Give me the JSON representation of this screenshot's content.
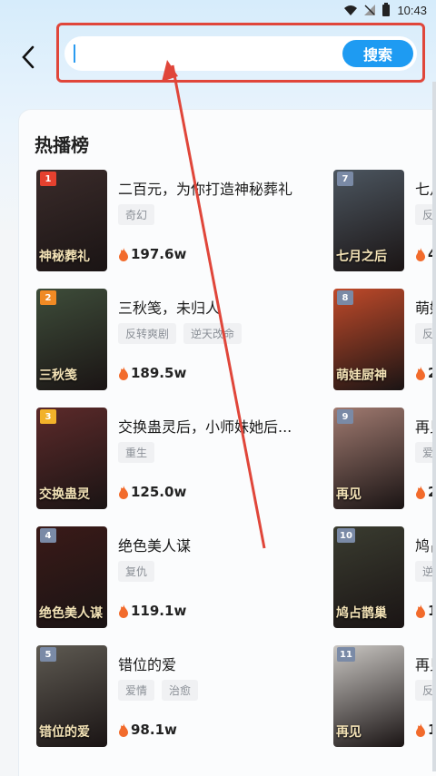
{
  "status": {
    "time": "10:43"
  },
  "search": {
    "placeholder": "",
    "value": "",
    "button_label": "搜索"
  },
  "section_title": "热播榜",
  "left_items": [
    {
      "rank": "1",
      "title": "二百元，为你打造神秘葬礼",
      "tags": [
        "奇幻"
      ],
      "heat": "197.6w",
      "poster_text": "神秘葬礼",
      "rank_color": "#e5412f",
      "poster_bg": "#3a2b2a"
    },
    {
      "rank": "2",
      "title": "三秋笺，未归人",
      "tags": [
        "反转爽剧",
        "逆天改命"
      ],
      "heat": "189.5w",
      "poster_text": "三秋笺",
      "rank_color": "#f08a24",
      "poster_bg": "#3e4d3a"
    },
    {
      "rank": "3",
      "title": "交换蛊灵后，小师妹她后...",
      "tags": [
        "重生"
      ],
      "heat": "125.0w",
      "poster_text": "交换蛊灵",
      "rank_color": "#f2b22a",
      "poster_bg": "#5c2a2a"
    },
    {
      "rank": "4",
      "title": "绝色美人谋",
      "tags": [
        "复仇"
      ],
      "heat": "119.1w",
      "poster_text": "绝色美人谋",
      "rank_color": "#7a8aa6",
      "poster_bg": "#3a1a18"
    },
    {
      "rank": "5",
      "title": "错位的爱",
      "tags": [
        "爱情",
        "治愈"
      ],
      "heat": "98.1w",
      "poster_text": "错位的爱",
      "rank_color": "#7a8aa6",
      "poster_bg": "#5e5a52"
    }
  ],
  "right_items": [
    {
      "rank": "7",
      "title": "七月",
      "tags": [
        "反转"
      ],
      "heat": "4",
      "poster_text": "七月之后",
      "rank_color": "#7a8aa6",
      "poster_bg": "#4c5660"
    },
    {
      "rank": "8",
      "title": "萌娃",
      "tags": [
        "反转"
      ],
      "heat": "2",
      "poster_text": "萌娃厨神",
      "rank_color": "#7a8aa6",
      "poster_bg": "#c04a2a"
    },
    {
      "rank": "9",
      "title": "再见",
      "tags": [
        "爱情"
      ],
      "heat": "2",
      "poster_text": "再见",
      "rank_color": "#7a8aa6",
      "poster_bg": "#a07a70"
    },
    {
      "rank": "10",
      "title": "鸠占",
      "tags": [
        "逆袭"
      ],
      "heat": "1",
      "poster_text": "鸠占鹊巢",
      "rank_color": "#7a8aa6",
      "poster_bg": "#3a3c30"
    },
    {
      "rank": "11",
      "title": "再见",
      "tags": [
        "反转"
      ],
      "heat": "1",
      "poster_text": "再见",
      "rank_color": "#7a8aa6",
      "poster_bg": "#c9c6c2"
    }
  ],
  "colors": {
    "accent": "#1e9bf2",
    "annotation": "#e0463a",
    "flame": "#f26b2c"
  }
}
